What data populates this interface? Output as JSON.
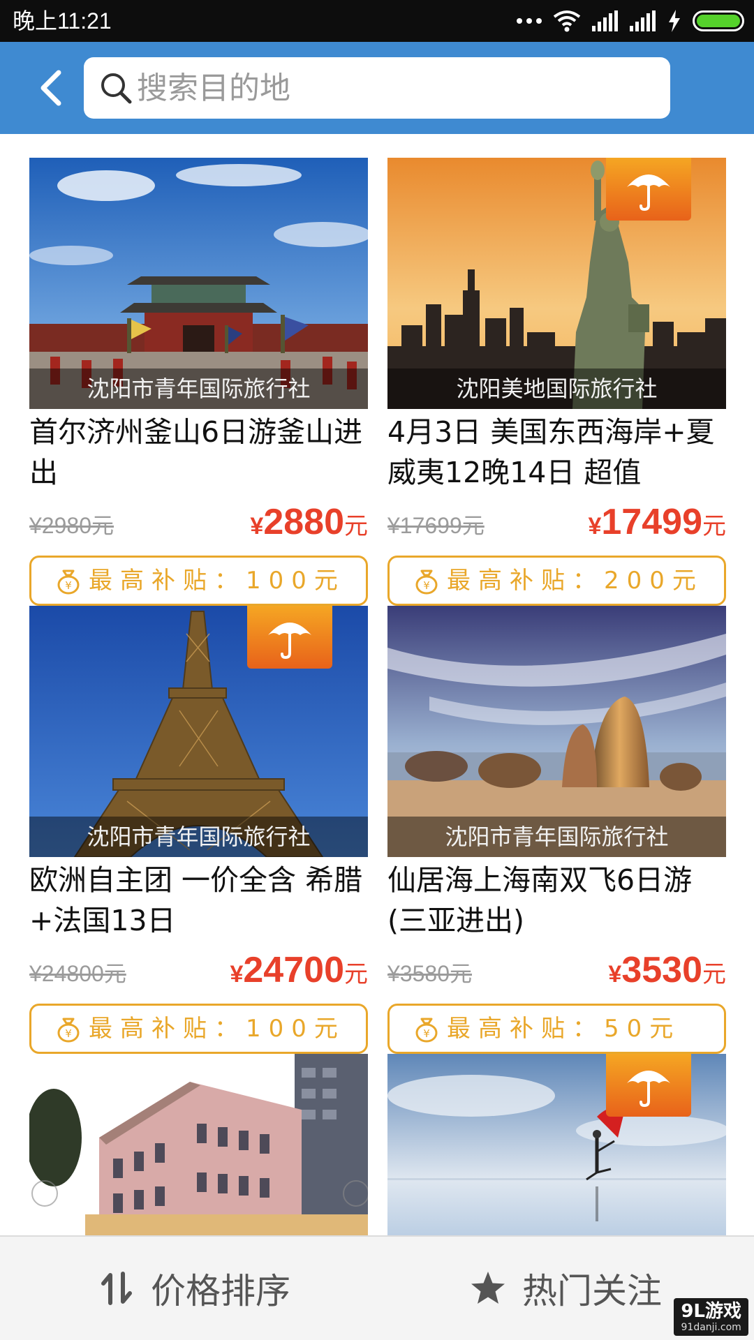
{
  "status_bar": {
    "time": "晚上11:21",
    "icons": [
      "more-dots-icon",
      "wifi-icon",
      "signal-icon",
      "signal-icon",
      "charging-bolt-icon",
      "battery-icon"
    ]
  },
  "header": {
    "back_icon": "chevron-left-icon",
    "search_placeholder": "搜索目的地",
    "search_value": ""
  },
  "products": [
    {
      "image_scene": "palace",
      "agency": "沈阳市青年国际旅行社",
      "insured_badge": false,
      "title": "首尔济州釜山6日游釜山进出",
      "old_price": "¥2980元",
      "currency": "¥",
      "price": "2880",
      "price_unit": "元",
      "subsidy": "最高补贴：100元"
    },
    {
      "image_scene": "liberty",
      "agency": "沈阳美地国际旅行社",
      "insured_badge": true,
      "title": "4月3日 美国东西海岸+夏威夷12晚14日 超值",
      "old_price": "¥17699元",
      "currency": "¥",
      "price": "17499",
      "price_unit": "元",
      "subsidy": "最高补贴：200元"
    },
    {
      "image_scene": "eiffel",
      "agency": "沈阳市青年国际旅行社",
      "insured_badge": true,
      "title": "欧洲自主团 一价全含 希腊+法国13日",
      "old_price": "¥24800元",
      "currency": "¥",
      "price": "24700",
      "price_unit": "元",
      "subsidy": "最高补贴：100元"
    },
    {
      "image_scene": "beach",
      "agency": "沈阳市青年国际旅行社",
      "insured_badge": false,
      "title": "仙居海上海南双飞6日游(三亚进出)",
      "old_price": "¥3580元",
      "currency": "¥",
      "price": "3530",
      "price_unit": "元",
      "subsidy": "最高补贴：50元"
    },
    {
      "image_scene": "building",
      "insured_badge": false
    },
    {
      "image_scene": "saltflat",
      "insured_badge": true
    }
  ],
  "bottom_bar": {
    "sort_label": "价格排序",
    "sort_icon": "sort-arrows-icon",
    "hot_label": "热门关注",
    "hot_icon": "star-icon"
  },
  "watermark": {
    "line1": "9L游戏",
    "line2": "91danji.com"
  },
  "colors": {
    "header_blue": "#3f8ad1",
    "price_red": "#e8402a",
    "subsidy_orange": "#e9a72a",
    "badge_orange": "#f08a1c"
  }
}
